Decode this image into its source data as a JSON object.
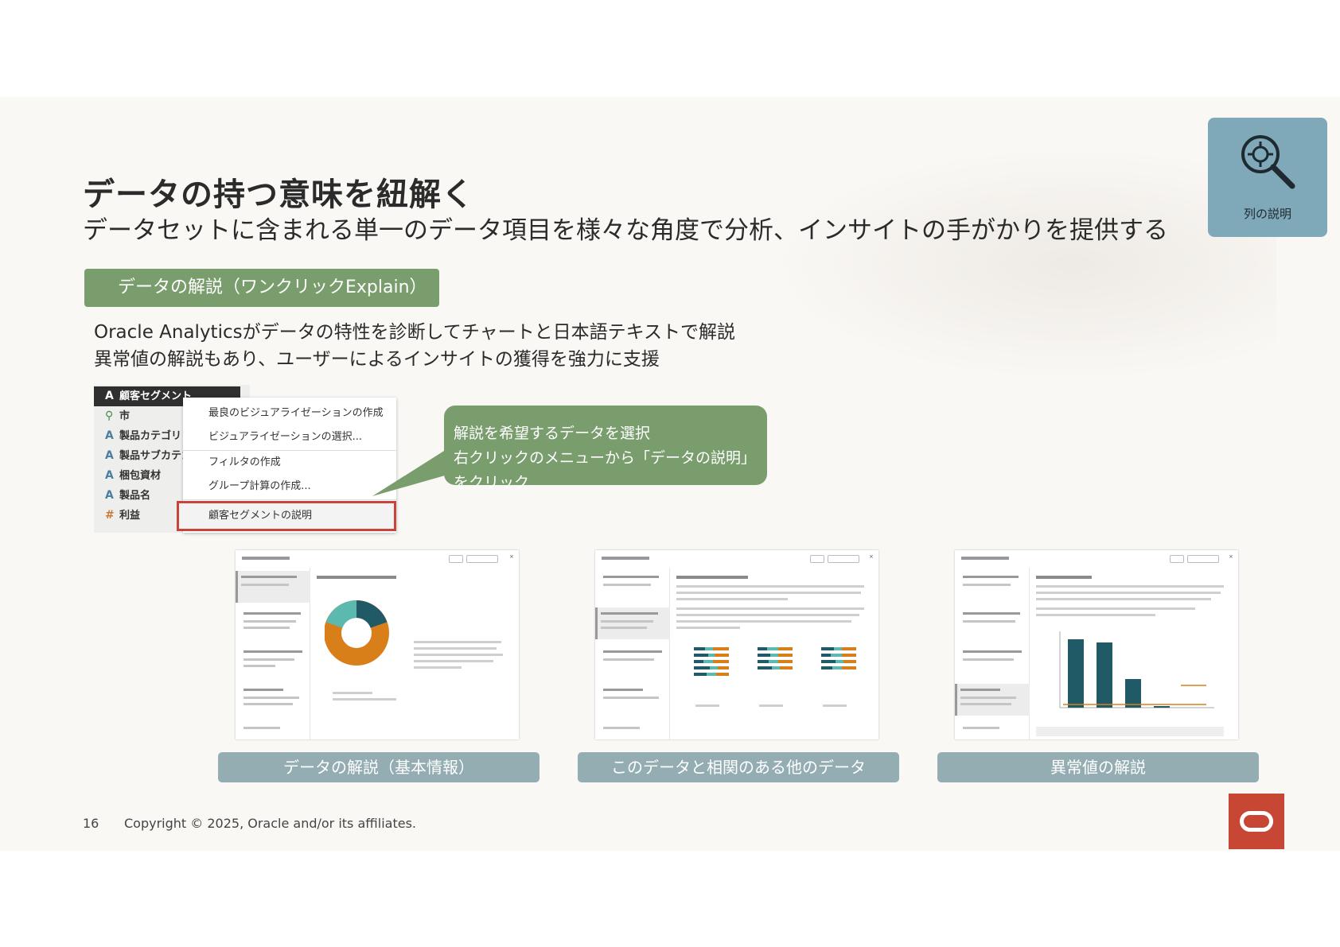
{
  "title": "データの持つ意味を紐解く",
  "subtitle": "データセットに含まれる単一のデータ項目を様々な角度で分析、インサイトの手がかりを提供する",
  "feature_box": {
    "label": "列の説明",
    "icon": "magnifier-target-icon"
  },
  "section_label": "データの解説（ワンクリックExplain）",
  "description": [
    "Oracle Analyticsがデータの特性を診断してチャートと日本語テキストで解説",
    "異常値の解説もあり、ユーザーによるインサイトの獲得を強力に支援"
  ],
  "fields": [
    {
      "label": "顧客セグメント",
      "icon": "A"
    },
    {
      "label": "市",
      "icon": "geo"
    },
    {
      "label": "製品カテゴリ",
      "icon": "A"
    },
    {
      "label": "製品サブカテゴ",
      "icon": "A"
    },
    {
      "label": "梱包資材",
      "icon": "A"
    },
    {
      "label": "製品名",
      "icon": "A"
    },
    {
      "label": "利益",
      "icon": "#"
    }
  ],
  "context_menu": [
    "最良のビジュアライゼーションの作成",
    "ビジュアライゼーションの選択...",
    "フィルタの作成",
    "グループ計算の作成...",
    "顧客セグメントの説明"
  ],
  "callout": [
    "解説を希望するデータを選択",
    "右クリックのメニューから「データの説明」をクリック"
  ],
  "captions": [
    "データの解説（基本情報）",
    "このデータと相関のある他のデータ",
    "異常値の解説"
  ],
  "footer": {
    "page": "16",
    "copyright": "Copyright © 2025, Oracle and/or its affiliates."
  },
  "colors": {
    "accent_green": "#7a9d6d",
    "caption_gray": "#93adb2",
    "oracle_red": "#c74634",
    "feature_blue": "#7fa8b8"
  }
}
